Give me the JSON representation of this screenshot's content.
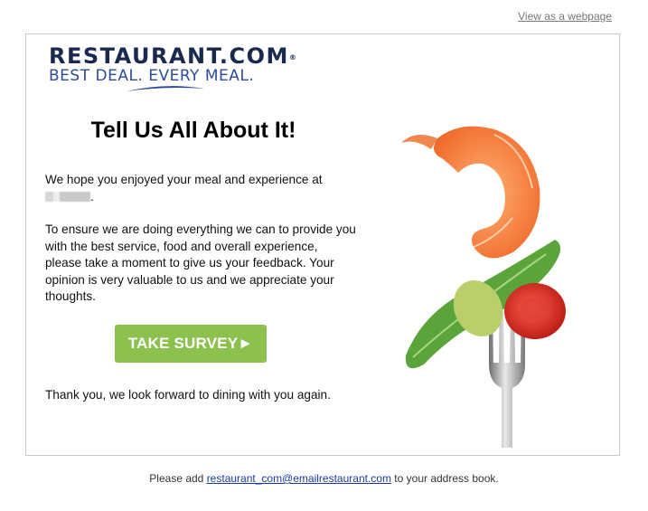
{
  "header": {
    "view_webpage": "View as a webpage"
  },
  "logo": {
    "brand": "RESTAURANT.COM",
    "registered": "®",
    "tagline": "BEST DEAL. EVERY MEAL."
  },
  "content": {
    "headline": "Tell Us All About It!",
    "paragraph1": "We hope you enjoyed your meal and experience at",
    "paragraph1_end": ".",
    "paragraph2": "To ensure we are doing everything we can to provide you with the best service, food and overall experience, please take a moment to give us your feedback. Your opinion is very valuable to us and we appreciate your thoughts.",
    "survey_button": "TAKE SURVEY►",
    "thanks": "Thank you, we look forward to dining with you again."
  },
  "footer": {
    "prefix": "Please add",
    "email": "restaurant_com@emailrestaurant.com",
    "suffix": "to your address book."
  },
  "colors": {
    "button": "#8cc04f",
    "brand_navy": "#1a2a4f",
    "brand_blue": "#2d4a9c",
    "link": "#1a3aa6"
  },
  "icons": [
    "fork-food-image",
    "logo-swoosh"
  ]
}
